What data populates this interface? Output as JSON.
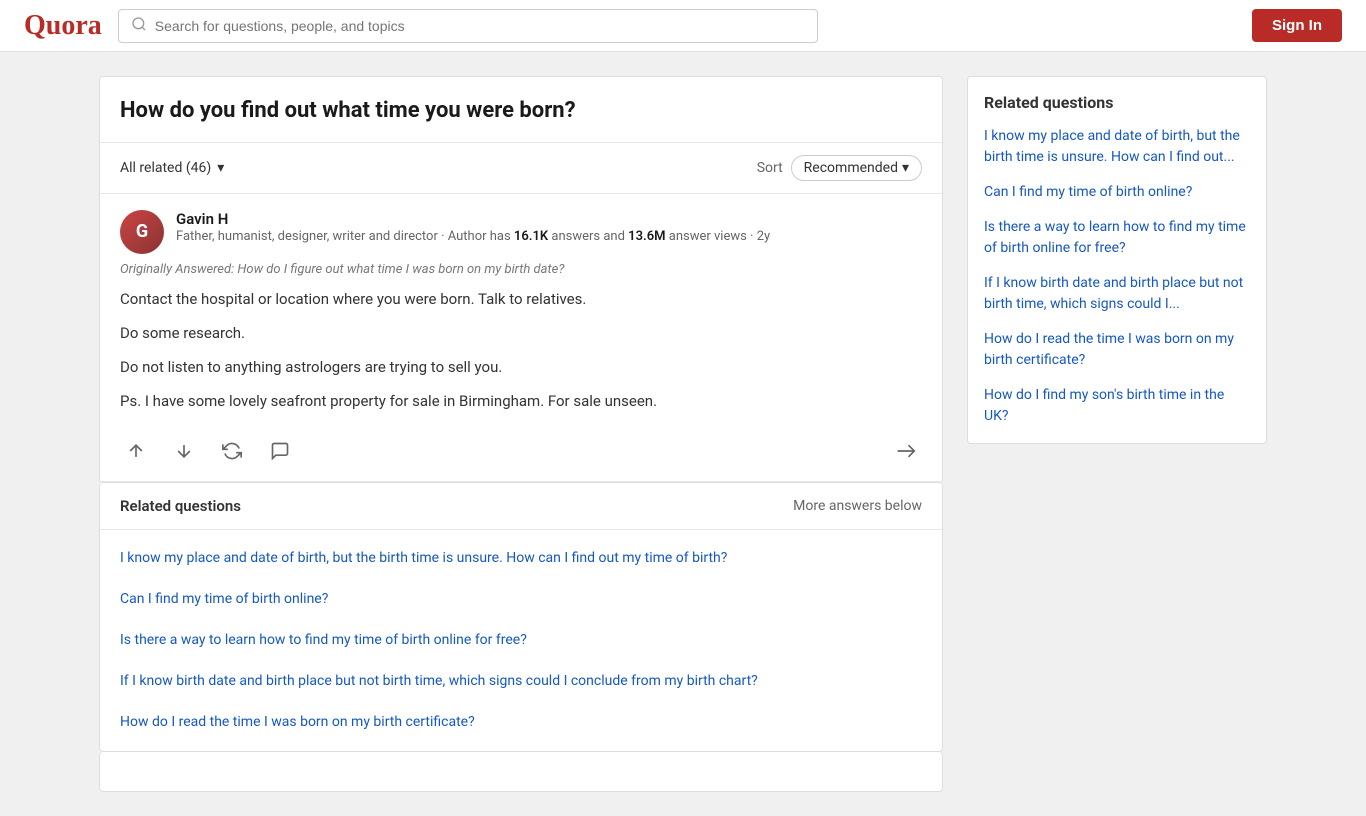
{
  "header": {
    "logo": "Quora",
    "search_placeholder": "Search for questions, people, and topics",
    "signin_label": "Sign In"
  },
  "main": {
    "question": {
      "title": "How do you find out what time you were born?"
    },
    "filter": {
      "all_related": "All related (46)",
      "sort_label": "Sort",
      "recommended": "Recommended"
    },
    "answer": {
      "author_name": "Gavin H",
      "author_bio": "Father, humanist, designer, writer and director · Author has",
      "answers_count": "16.1K",
      "answers_label": "answers and",
      "views_count": "13.6M",
      "views_label": "answer views ·",
      "time_ago": "2y",
      "originally_answered": "Originally Answered: How do I figure out what time I was born on my birth date?",
      "paragraphs": [
        "Contact the hospital or location where you were born. Talk to relatives.",
        "Do some research.",
        "Do not listen to anything astrologers are trying to sell you.",
        "Ps. I have some lovely seafront property for sale in Birmingham. For sale unseen."
      ]
    },
    "related_inline": {
      "title": "Related questions",
      "more_answers": "More answers below",
      "items": [
        "I know my place and date of birth, but the birth time is unsure. How can I find out my time of birth?",
        "Can I find my time of birth online?",
        "Is there a way to learn how to find my time of birth online for free?",
        "If I know birth date and birth place but not birth time, which signs could I conclude from my birth chart?",
        "How do I read the time I was born on my birth certificate?"
      ]
    }
  },
  "sidebar": {
    "title": "Related questions",
    "items": [
      "I know my place and date of birth, but the birth time is unsure. How can I find out...",
      "Can I find my time of birth online?",
      "Is there a way to learn how to find my time of birth online for free?",
      "If I know birth date and birth place but not birth time, which signs could I...",
      "How do I read the time I was born on my birth certificate?",
      "How do I find my son's birth time in the UK?"
    ]
  }
}
